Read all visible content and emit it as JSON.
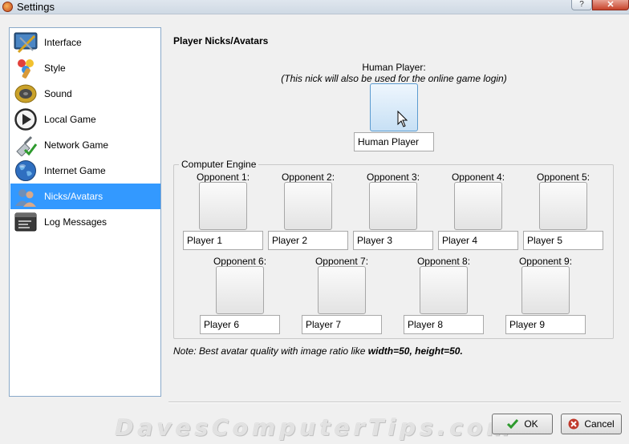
{
  "window": {
    "title": "Settings",
    "help_label": "?",
    "close_label": "✕"
  },
  "sidebar": {
    "items": [
      {
        "label": "Interface",
        "icon": "interface-icon"
      },
      {
        "label": "Style",
        "icon": "style-icon"
      },
      {
        "label": "Sound",
        "icon": "sound-icon"
      },
      {
        "label": "Local Game",
        "icon": "play-icon"
      },
      {
        "label": "Network Game",
        "icon": "network-icon"
      },
      {
        "label": "Internet Game",
        "icon": "globe-icon"
      },
      {
        "label": "Nicks/Avatars",
        "icon": "users-icon",
        "selected": true
      },
      {
        "label": "Log Messages",
        "icon": "log-icon"
      }
    ]
  },
  "panel": {
    "title": "Player Nicks/Avatars",
    "human": {
      "label": "Human Player:",
      "note": "(This nick will also be used for the online game login)",
      "nick": "Human Player"
    },
    "computer_engine": {
      "legend": "Computer Engine",
      "opponents": [
        {
          "label": "Opponent 1:",
          "nick": "Player 1"
        },
        {
          "label": "Opponent 2:",
          "nick": "Player 2"
        },
        {
          "label": "Opponent 3:",
          "nick": "Player 3"
        },
        {
          "label": "Opponent 4:",
          "nick": "Player 4"
        },
        {
          "label": "Opponent 5:",
          "nick": "Player 5"
        },
        {
          "label": "Opponent 6:",
          "nick": "Player 6"
        },
        {
          "label": "Opponent 7:",
          "nick": "Player 7"
        },
        {
          "label": "Opponent 8:",
          "nick": "Player 8"
        },
        {
          "label": "Opponent 9:",
          "nick": "Player 9"
        }
      ]
    },
    "note": {
      "prefix": "Note: Best avatar quality with image ratio like ",
      "emphasis": "width=50, height=50."
    }
  },
  "footer": {
    "watermark": "DavesComputerTips.com",
    "ok_label": "OK",
    "cancel_label": "Cancel"
  },
  "colors": {
    "selection": "#3399ff",
    "sidebar_border": "#8aa9c9",
    "ok_check": "#2e9a2e",
    "cancel_x": "#c0392b"
  }
}
